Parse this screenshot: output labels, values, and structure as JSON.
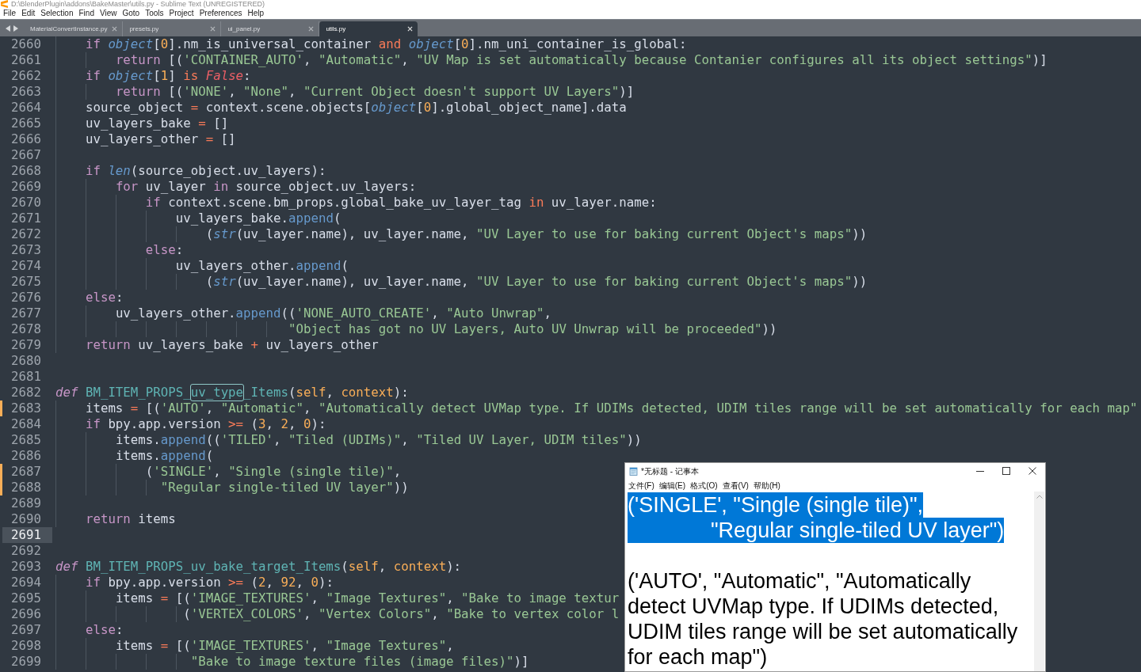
{
  "window": {
    "title": "D:\\BlenderPlugin\\addons\\BakeMaster\\utils.py - Sublime Text (UNREGISTERED)"
  },
  "menu": [
    "File",
    "Edit",
    "Selection",
    "Find",
    "View",
    "Goto",
    "Tools",
    "Project",
    "Preferences",
    "Help"
  ],
  "tabs": [
    {
      "label": "MaterialConvertInstance.py",
      "selected": false
    },
    {
      "label": "presets.py",
      "selected": false
    },
    {
      "label": "ui_panel.py",
      "selected": false
    },
    {
      "label": "utils.py",
      "selected": true
    }
  ],
  "editor": {
    "lines": [
      {
        "number": "2660",
        "modified": false,
        "current": false,
        "tokens": [
          {
            "kind": "kw",
            "text": "    if "
          },
          {
            "kind": "builtin",
            "text": "object"
          },
          {
            "kind": "plain",
            "text": "["
          },
          {
            "kind": "num",
            "text": "0"
          },
          {
            "kind": "plain",
            "text": "].nm_is_universal_container "
          },
          {
            "kind": "op",
            "text": "and "
          },
          {
            "kind": "builtin",
            "text": "object"
          },
          {
            "kind": "plain",
            "text": "["
          },
          {
            "kind": "num",
            "text": "0"
          },
          {
            "kind": "plain",
            "text": "].nm_uni_container_is_global:"
          }
        ]
      },
      {
        "number": "2661",
        "modified": false,
        "current": false,
        "tokens": [
          {
            "kind": "kw",
            "text": "        return"
          },
          {
            "kind": "plain",
            "text": " [("
          },
          {
            "kind": "str",
            "text": "'CONTAINER_AUTO'"
          },
          {
            "kind": "plain",
            "text": ", "
          },
          {
            "kind": "str",
            "text": "\"Automatic\""
          },
          {
            "kind": "plain",
            "text": ", "
          },
          {
            "kind": "str",
            "text": "\"UV Map is set automatically because Contanier configures all its object settings\""
          },
          {
            "kind": "plain",
            "text": ")]"
          }
        ]
      },
      {
        "number": "2662",
        "modified": false,
        "current": false,
        "tokens": [
          {
            "kind": "kw",
            "text": "    if "
          },
          {
            "kind": "builtin",
            "text": "object"
          },
          {
            "kind": "plain",
            "text": "["
          },
          {
            "kind": "num",
            "text": "1"
          },
          {
            "kind": "plain",
            "text": "] "
          },
          {
            "kind": "op",
            "text": "is "
          },
          {
            "kind": "const",
            "text": "False"
          },
          {
            "kind": "plain",
            "text": ":"
          }
        ]
      },
      {
        "number": "2663",
        "modified": false,
        "current": false,
        "tokens": [
          {
            "kind": "kw",
            "text": "        return"
          },
          {
            "kind": "plain",
            "text": " [("
          },
          {
            "kind": "str",
            "text": "'NONE'"
          },
          {
            "kind": "plain",
            "text": ", "
          },
          {
            "kind": "str",
            "text": "\"None\""
          },
          {
            "kind": "plain",
            "text": ", "
          },
          {
            "kind": "str",
            "text": "\"Current Object doesn't support UV Layers\""
          },
          {
            "kind": "plain",
            "text": ")]"
          }
        ]
      },
      {
        "number": "2664",
        "modified": false,
        "current": false,
        "tokens": [
          {
            "kind": "plain",
            "text": "    source_object "
          },
          {
            "kind": "op",
            "text": "="
          },
          {
            "kind": "plain",
            "text": " context.scene.objects["
          },
          {
            "kind": "builtin",
            "text": "object"
          },
          {
            "kind": "plain",
            "text": "["
          },
          {
            "kind": "num",
            "text": "0"
          },
          {
            "kind": "plain",
            "text": "].global_object_name].data"
          }
        ]
      },
      {
        "number": "2665",
        "modified": false,
        "current": false,
        "tokens": [
          {
            "kind": "plain",
            "text": "    uv_layers_bake "
          },
          {
            "kind": "op",
            "text": "="
          },
          {
            "kind": "plain",
            "text": " []"
          }
        ]
      },
      {
        "number": "2666",
        "modified": false,
        "current": false,
        "tokens": [
          {
            "kind": "plain",
            "text": "    uv_layers_other "
          },
          {
            "kind": "op",
            "text": "="
          },
          {
            "kind": "plain",
            "text": " []"
          }
        ]
      },
      {
        "number": "2667",
        "modified": false,
        "current": false
      },
      {
        "number": "2668",
        "modified": false,
        "current": false,
        "tokens": [
          {
            "kind": "kw",
            "text": "    if "
          },
          {
            "kind": "builtin",
            "text": "len"
          },
          {
            "kind": "plain",
            "text": "(source_object.uv_layers):"
          }
        ]
      },
      {
        "number": "2669",
        "modified": false,
        "current": false,
        "tokens": [
          {
            "kind": "kw",
            "text": "        for"
          },
          {
            "kind": "plain",
            "text": " uv_layer "
          },
          {
            "kind": "kw",
            "text": "in"
          },
          {
            "kind": "plain",
            "text": " source_object.uv_layers:"
          }
        ]
      },
      {
        "number": "2670",
        "modified": false,
        "current": false,
        "tokens": [
          {
            "kind": "kw",
            "text": "            if"
          },
          {
            "kind": "plain",
            "text": " context.scene.bm_props.global_bake_uv_layer_tag "
          },
          {
            "kind": "op",
            "text": "in"
          },
          {
            "kind": "plain",
            "text": " uv_layer.name:"
          }
        ]
      },
      {
        "number": "2671",
        "modified": false,
        "current": false,
        "tokens": [
          {
            "kind": "plain",
            "text": "                uv_layers_bake."
          },
          {
            "kind": "method",
            "text": "append"
          },
          {
            "kind": "plain",
            "text": "("
          }
        ]
      },
      {
        "number": "2672",
        "modified": false,
        "current": false,
        "tokens": [
          {
            "kind": "plain",
            "text": "                    ("
          },
          {
            "kind": "builtin",
            "text": "str"
          },
          {
            "kind": "plain",
            "text": "(uv_layer.name), uv_layer.name, "
          },
          {
            "kind": "str",
            "text": "\"UV Layer to use for baking current Object's maps\""
          },
          {
            "kind": "plain",
            "text": "))"
          }
        ]
      },
      {
        "number": "2673",
        "modified": false,
        "current": false,
        "tokens": [
          {
            "kind": "kw",
            "text": "            else"
          },
          {
            "kind": "plain",
            "text": ":"
          }
        ]
      },
      {
        "number": "2674",
        "modified": false,
        "current": false,
        "tokens": [
          {
            "kind": "plain",
            "text": "                uv_layers_other."
          },
          {
            "kind": "method",
            "text": "append"
          },
          {
            "kind": "plain",
            "text": "("
          }
        ]
      },
      {
        "number": "2675",
        "modified": false,
        "current": false,
        "tokens": [
          {
            "kind": "plain",
            "text": "                    ("
          },
          {
            "kind": "builtin",
            "text": "str"
          },
          {
            "kind": "plain",
            "text": "(uv_layer.name), uv_layer.name, "
          },
          {
            "kind": "str",
            "text": "\"UV Layer to use for baking current Object's maps\""
          },
          {
            "kind": "plain",
            "text": "))"
          }
        ]
      },
      {
        "number": "2676",
        "modified": false,
        "current": false,
        "tokens": [
          {
            "kind": "kw",
            "text": "    else"
          },
          {
            "kind": "plain",
            "text": ":"
          }
        ]
      },
      {
        "number": "2677",
        "modified": false,
        "current": false,
        "tokens": [
          {
            "kind": "plain",
            "text": "        uv_layers_other."
          },
          {
            "kind": "method",
            "text": "append"
          },
          {
            "kind": "plain",
            "text": "(("
          },
          {
            "kind": "str",
            "text": "'NONE_AUTO_CREATE'"
          },
          {
            "kind": "plain",
            "text": ", "
          },
          {
            "kind": "str",
            "text": "\"Auto Unwrap\""
          },
          {
            "kind": "plain",
            "text": ","
          }
        ]
      },
      {
        "number": "2678",
        "modified": false,
        "current": false,
        "tokens": [
          {
            "kind": "str",
            "text": "                               \"Object has got no UV Layers, Auto UV Unwrap will be proceeded\""
          },
          {
            "kind": "plain",
            "text": "))"
          }
        ]
      },
      {
        "number": "2679",
        "modified": false,
        "current": false,
        "tokens": [
          {
            "kind": "kw",
            "text": "    return"
          },
          {
            "kind": "plain",
            "text": " uv_layers_bake "
          },
          {
            "kind": "op",
            "text": "+"
          },
          {
            "kind": "plain",
            "text": " uv_layers_other"
          }
        ]
      },
      {
        "number": "2680",
        "modified": false,
        "current": false
      },
      {
        "number": "2681",
        "modified": false,
        "current": false
      },
      {
        "number": "2682",
        "modified": false,
        "current": false,
        "tokens": [
          {
            "kind": "def",
            "text": "def "
          },
          {
            "kind": "func",
            "text": "BM_ITEM_PROPS_"
          },
          {
            "kind": "match",
            "text": "uv_type"
          },
          {
            "kind": "func",
            "text": "_Items"
          },
          {
            "kind": "plain",
            "text": "("
          },
          {
            "kind": "param",
            "text": "self"
          },
          {
            "kind": "plain",
            "text": ", "
          },
          {
            "kind": "param",
            "text": "context"
          },
          {
            "kind": "plain",
            "text": "):"
          }
        ]
      },
      {
        "number": "2683",
        "modified": true,
        "current": false,
        "tokens": [
          {
            "kind": "plain",
            "text": "    items "
          },
          {
            "kind": "op",
            "text": "="
          },
          {
            "kind": "plain",
            "text": " [("
          },
          {
            "kind": "str",
            "text": "'AUTO'"
          },
          {
            "kind": "plain",
            "text": ", "
          },
          {
            "kind": "str",
            "text": "\"Automatic\""
          },
          {
            "kind": "plain",
            "text": ", "
          },
          {
            "kind": "str",
            "text": "\"Automatically detect UVMap type. If UDIMs detected, UDIM tiles range will be set automatically for each map\""
          }
        ]
      },
      {
        "number": "2684",
        "modified": false,
        "current": false,
        "tokens": [
          {
            "kind": "kw",
            "text": "    if"
          },
          {
            "kind": "plain",
            "text": " bpy.app.version "
          },
          {
            "kind": "op",
            "text": ">="
          },
          {
            "kind": "plain",
            "text": " ("
          },
          {
            "kind": "num",
            "text": "3"
          },
          {
            "kind": "plain",
            "text": ", "
          },
          {
            "kind": "num",
            "text": "2"
          },
          {
            "kind": "plain",
            "text": ", "
          },
          {
            "kind": "num",
            "text": "0"
          },
          {
            "kind": "plain",
            "text": "):"
          }
        ]
      },
      {
        "number": "2685",
        "modified": false,
        "current": false,
        "tokens": [
          {
            "kind": "plain",
            "text": "        items."
          },
          {
            "kind": "method",
            "text": "append"
          },
          {
            "kind": "plain",
            "text": "(("
          },
          {
            "kind": "str",
            "text": "'TILED'"
          },
          {
            "kind": "plain",
            "text": ", "
          },
          {
            "kind": "str",
            "text": "\"Tiled (UDIMs)\""
          },
          {
            "kind": "plain",
            "text": ", "
          },
          {
            "kind": "str",
            "text": "\"Tiled UV Layer, UDIM tiles\""
          },
          {
            "kind": "plain",
            "text": "))"
          }
        ]
      },
      {
        "number": "2686",
        "modified": false,
        "current": false,
        "tokens": [
          {
            "kind": "plain",
            "text": "        items."
          },
          {
            "kind": "method",
            "text": "append"
          },
          {
            "kind": "plain",
            "text": "("
          }
        ]
      },
      {
        "number": "2687",
        "modified": true,
        "current": false,
        "tokens": [
          {
            "kind": "plain",
            "text": "            ("
          },
          {
            "kind": "str",
            "text": "'SINGLE'"
          },
          {
            "kind": "plain",
            "text": ", "
          },
          {
            "kind": "str",
            "text": "\"Single (single tile)\""
          },
          {
            "kind": "plain",
            "text": ","
          }
        ]
      },
      {
        "number": "2688",
        "modified": true,
        "current": false,
        "tokens": [
          {
            "kind": "str",
            "text": "              \"Regular single-tiled UV layer\""
          },
          {
            "kind": "plain",
            "text": "))"
          }
        ]
      },
      {
        "number": "2689",
        "modified": false,
        "current": false
      },
      {
        "number": "2690",
        "modified": false,
        "current": false,
        "tokens": [
          {
            "kind": "kw",
            "text": "    return"
          },
          {
            "kind": "plain",
            "text": " items"
          }
        ]
      },
      {
        "number": "2691",
        "modified": false,
        "current": true
      },
      {
        "number": "2692",
        "modified": false,
        "current": false
      },
      {
        "number": "2693",
        "modified": false,
        "current": false,
        "tokens": [
          {
            "kind": "def",
            "text": "def "
          },
          {
            "kind": "func",
            "text": "BM_ITEM_PROPS_uv_bake_target_Items"
          },
          {
            "kind": "plain",
            "text": "("
          },
          {
            "kind": "param",
            "text": "self"
          },
          {
            "kind": "plain",
            "text": ", "
          },
          {
            "kind": "param",
            "text": "context"
          },
          {
            "kind": "plain",
            "text": "):"
          }
        ]
      },
      {
        "number": "2694",
        "modified": false,
        "current": false,
        "tokens": [
          {
            "kind": "kw",
            "text": "    if"
          },
          {
            "kind": "plain",
            "text": " bpy.app.version "
          },
          {
            "kind": "op",
            "text": ">="
          },
          {
            "kind": "plain",
            "text": " ("
          },
          {
            "kind": "num",
            "text": "2"
          },
          {
            "kind": "plain",
            "text": ", "
          },
          {
            "kind": "num",
            "text": "92"
          },
          {
            "kind": "plain",
            "text": ", "
          },
          {
            "kind": "num",
            "text": "0"
          },
          {
            "kind": "plain",
            "text": "):"
          }
        ]
      },
      {
        "number": "2695",
        "modified": false,
        "current": false,
        "tokens": [
          {
            "kind": "plain",
            "text": "        items "
          },
          {
            "kind": "op",
            "text": "="
          },
          {
            "kind": "plain",
            "text": " [("
          },
          {
            "kind": "str",
            "text": "'IMAGE_TEXTURES'"
          },
          {
            "kind": "plain",
            "text": ", "
          },
          {
            "kind": "str",
            "text": "\"Image Textures\""
          },
          {
            "kind": "plain",
            "text": ", "
          },
          {
            "kind": "str",
            "text": "\"Bake to image textur"
          }
        ]
      },
      {
        "number": "2696",
        "modified": false,
        "current": false,
        "tokens": [
          {
            "kind": "plain",
            "text": "                 ("
          },
          {
            "kind": "str",
            "text": "'VERTEX_COLORS'"
          },
          {
            "kind": "plain",
            "text": ", "
          },
          {
            "kind": "str",
            "text": "\"Vertex Colors\""
          },
          {
            "kind": "plain",
            "text": ", "
          },
          {
            "kind": "str",
            "text": "\"Bake to vertex color l"
          }
        ]
      },
      {
        "number": "2697",
        "modified": false,
        "current": false,
        "tokens": [
          {
            "kind": "kw",
            "text": "    else"
          },
          {
            "kind": "plain",
            "text": ":"
          }
        ]
      },
      {
        "number": "2698",
        "modified": false,
        "current": false,
        "tokens": [
          {
            "kind": "plain",
            "text": "        items "
          },
          {
            "kind": "op",
            "text": "="
          },
          {
            "kind": "plain",
            "text": " [("
          },
          {
            "kind": "str",
            "text": "'IMAGE_TEXTURES'"
          },
          {
            "kind": "plain",
            "text": ", "
          },
          {
            "kind": "str",
            "text": "\"Image Textures\""
          },
          {
            "kind": "plain",
            "text": ","
          }
        ]
      },
      {
        "number": "2699",
        "modified": false,
        "current": false,
        "tokens": [
          {
            "kind": "str",
            "text": "                  \"Bake to image texture files (image files)\""
          },
          {
            "kind": "plain",
            "text": ")]"
          }
        ]
      }
    ]
  },
  "notepad": {
    "title": "*无标题 - 记事本",
    "menu": [
      "文件(F)",
      "编辑(E)",
      "格式(O)",
      "查看(V)",
      "帮助(H)"
    ],
    "paragraphs": [
      {
        "selected": true,
        "lines": [
          "('SINGLE', \"Single (single tile)\",",
          "              \"Regular single-tiled UV layer\")"
        ]
      },
      {
        "selected": false,
        "lines": [
          "('AUTO', \"Automatic\", \"Automatically detect UVMap type. If UDIMs detected, UDIM tiles range will be set automatically for each map\")"
        ]
      }
    ]
  }
}
